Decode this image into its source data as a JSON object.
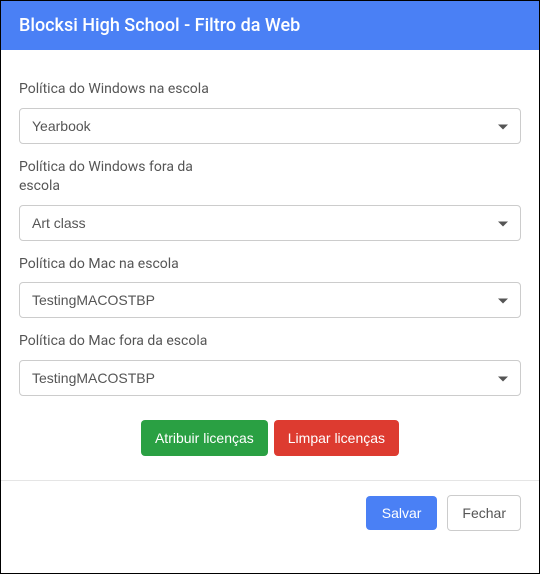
{
  "header": {
    "title": "Blocksi High School - Filtro da Web"
  },
  "fields": {
    "windows_in_school": {
      "label": "Política do Windows na escola",
      "value": "Yearbook"
    },
    "windows_out_school": {
      "label": "Política do Windows fora da escola",
      "value": "Art class"
    },
    "mac_in_school": {
      "label": "Política do Mac na escola",
      "value": "TestingMACOSTBP"
    },
    "mac_out_school": {
      "label": "Política do Mac fora da escola",
      "value": "TestingMACOSTBP"
    }
  },
  "actions": {
    "assign_licenses": "Atribuir licenças",
    "clear_licenses": "Limpar licenças",
    "save": "Salvar",
    "close": "Fechar"
  }
}
